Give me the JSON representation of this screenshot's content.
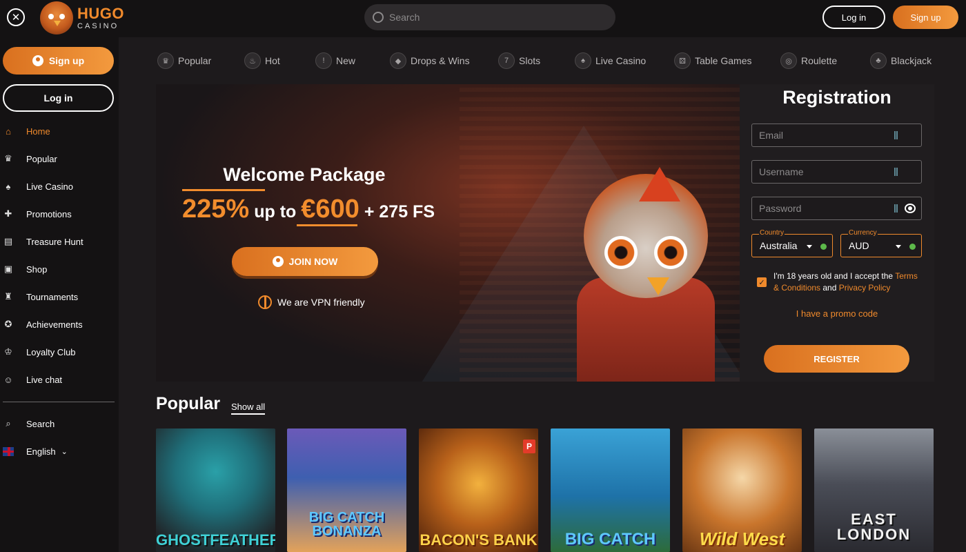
{
  "header": {
    "logo_line1": "HUGO",
    "logo_line2": "CASINO",
    "search_placeholder": "Search",
    "login_label": "Log in",
    "signup_label": "Sign up"
  },
  "sidebar": {
    "signup_label": "Sign up",
    "login_label": "Log in",
    "items": [
      {
        "label": "Home",
        "icon": "home-icon",
        "glyph": "⌂"
      },
      {
        "label": "Popular",
        "icon": "crown-icon",
        "glyph": "♛"
      },
      {
        "label": "Live Casino",
        "icon": "cards-icon",
        "glyph": "♠"
      },
      {
        "label": "Promotions",
        "icon": "gift-icon",
        "glyph": "✚"
      },
      {
        "label": "Treasure Hunt",
        "icon": "chest-icon",
        "glyph": "▤"
      },
      {
        "label": "Shop",
        "icon": "shop-icon",
        "glyph": "▣"
      },
      {
        "label": "Tournaments",
        "icon": "trophy-icon",
        "glyph": "♜"
      },
      {
        "label": "Achievements",
        "icon": "medal-icon",
        "glyph": "✪"
      },
      {
        "label": "Loyalty Club",
        "icon": "crown-icon",
        "glyph": "♔"
      },
      {
        "label": "Live chat",
        "icon": "chat-icon",
        "glyph": "☺"
      }
    ],
    "search_label": "Search",
    "language_label": "English"
  },
  "categories": [
    {
      "label": "Popular",
      "glyph": "♛"
    },
    {
      "label": "Hot",
      "glyph": "♨"
    },
    {
      "label": "New",
      "glyph": "!"
    },
    {
      "label": "Drops & Wins",
      "glyph": "◆"
    },
    {
      "label": "Slots",
      "glyph": "7"
    },
    {
      "label": "Live Casino",
      "glyph": "♠"
    },
    {
      "label": "Table Games",
      "glyph": "⚄"
    },
    {
      "label": "Roulette",
      "glyph": "◎"
    },
    {
      "label": "Blackjack",
      "glyph": "♣"
    }
  ],
  "hero": {
    "title": "Welcome Package",
    "percent": "225%",
    "up_to": "up to",
    "amount": "€600",
    "spins": "+ 275 FS",
    "join_label": "JOIN NOW",
    "vpn_text": "We are VPN friendly"
  },
  "registration": {
    "title": "Registration",
    "email_placeholder": "Email",
    "username_placeholder": "Username",
    "password_placeholder": "Password",
    "country_label": "Country",
    "country_value": "Australia",
    "currency_label": "Currency",
    "currency_value": "AUD",
    "terms_prefix": "I'm 18 years old and I accept the ",
    "terms_link": "Terms & Conditions",
    "terms_and": " and ",
    "privacy_link": "Privacy Policy",
    "promo_label": "I have a promo code",
    "register_label": "REGISTER"
  },
  "popular": {
    "title": "Popular",
    "show_all": "Show all",
    "games": [
      {
        "title": "GHOSTFEATHER",
        "bg": "#1f6f7a"
      },
      {
        "title": "BIG CATCH BONANZA",
        "bg": "#2e4f9c"
      },
      {
        "title": "BACON'S BANK",
        "bg": "#7a3a14",
        "badge": "P"
      },
      {
        "title": "BIG CATCH",
        "bg": "#1e72a8"
      },
      {
        "title": "Wild West",
        "bg": "#c9752c"
      },
      {
        "title": "EAST LONDON",
        "bg": "#3d3f4a"
      }
    ]
  },
  "colors": {
    "accent": "#f08a2c",
    "background": "#1d1a1c",
    "sidebar": "#141213"
  }
}
